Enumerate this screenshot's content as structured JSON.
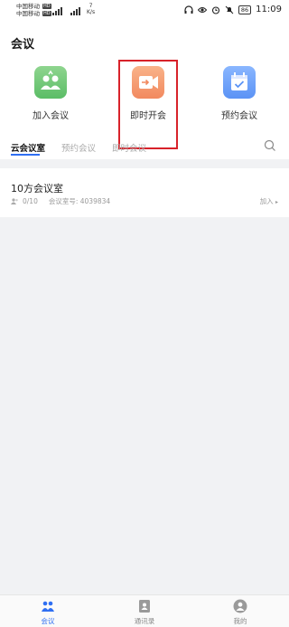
{
  "status": {
    "carrier1": "中国移动",
    "carrier2": "中国移动",
    "hd": "HD",
    "net1": "4G",
    "net2": "4G",
    "speed_value": "7",
    "speed_unit": "K/s",
    "battery": "86",
    "time": "11:09"
  },
  "page": {
    "title": "会议"
  },
  "actions": [
    {
      "label": "加入会议",
      "icon": "join-meeting-icon",
      "color": "#5bbd66"
    },
    {
      "label": "即时开会",
      "icon": "instant-meeting-icon",
      "color": "#f2895f"
    },
    {
      "label": "预约会议",
      "icon": "schedule-calendar-icon",
      "color": "#5b93f5"
    }
  ],
  "tabs": [
    {
      "label": "云会议室",
      "active": true
    },
    {
      "label": "预约会议",
      "active": false
    },
    {
      "label": "即时会议",
      "active": false
    }
  ],
  "room": {
    "name": "10方会议室",
    "capacity": "0/10",
    "id_label": "会议室号: 4039834",
    "join_label": "加入"
  },
  "bottom_nav": [
    {
      "label": "会议",
      "active": true
    },
    {
      "label": "通讯录",
      "active": false
    },
    {
      "label": "我的",
      "active": false
    }
  ],
  "colors": {
    "accent": "#2f6ff2",
    "highlight": "#d8222a"
  }
}
